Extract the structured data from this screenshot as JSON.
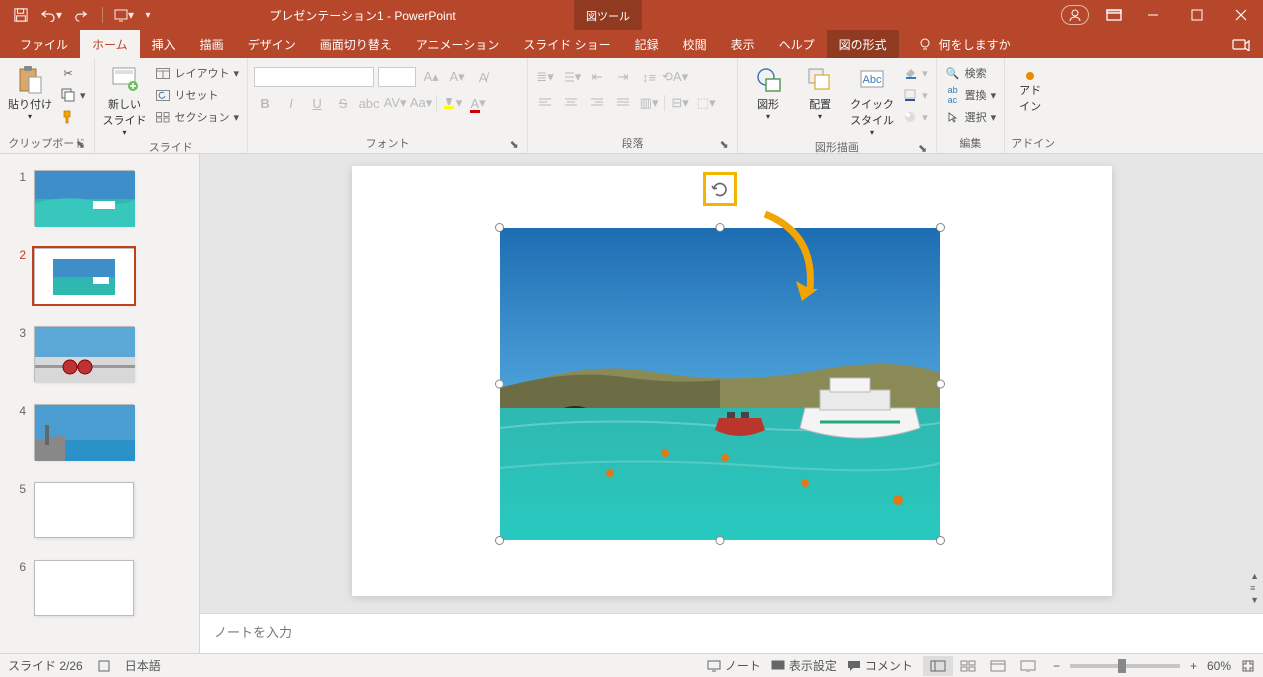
{
  "window": {
    "title": "プレゼンテーション1 - PowerPoint",
    "contextual_tab_title": "図ツール"
  },
  "tabs": {
    "file": "ファイル",
    "home": "ホーム",
    "insert": "挿入",
    "draw": "描画",
    "design": "デザイン",
    "transitions": "画面切り替え",
    "animations": "アニメーション",
    "slideshow": "スライド ショー",
    "record": "記録",
    "review": "校閲",
    "view": "表示",
    "help": "ヘルプ",
    "picture_format": "図の形式",
    "tellme": "何をしますか"
  },
  "ribbon": {
    "clipboard": {
      "paste": "貼り付け",
      "label": "クリップボード"
    },
    "slides": {
      "new_slide": "新しい\nスライド",
      "layout": "レイアウト",
      "reset": "リセット",
      "section": "セクション",
      "label": "スライド"
    },
    "font": {
      "label": "フォント"
    },
    "paragraph": {
      "label": "段落"
    },
    "drawing": {
      "shapes": "図形",
      "arrange": "配置",
      "quick_styles": "クイック\nスタイル",
      "label": "図形描画"
    },
    "editing": {
      "find": "検索",
      "replace": "置換",
      "select": "選択",
      "label": "編集"
    },
    "addins": {
      "addins": "アド\nイン",
      "label": "アドイン"
    }
  },
  "thumbs": {
    "n1": "1",
    "n2": "2",
    "n3": "3",
    "n4": "4",
    "n5": "5",
    "n6": "6"
  },
  "notes": {
    "placeholder": "ノートを入力"
  },
  "status": {
    "slide_indicator": "スライド 2/26",
    "language": "日本語",
    "notes": "ノート",
    "display_settings": "表示設定",
    "comments": "コメント",
    "zoom_pct": "60%"
  }
}
